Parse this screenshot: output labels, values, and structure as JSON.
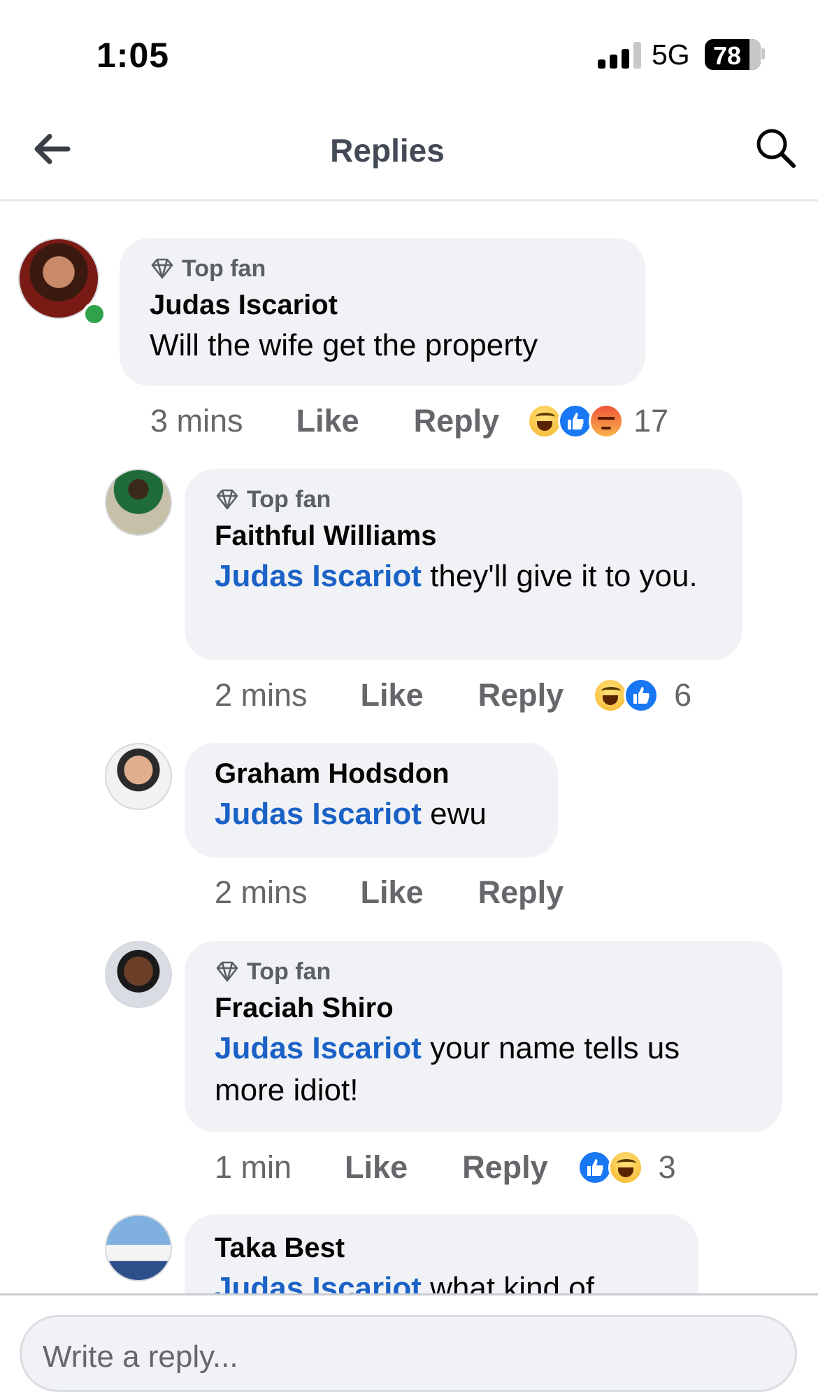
{
  "status": {
    "time": "1:05",
    "network": "5G",
    "battery": "78",
    "battery_level": 0.78
  },
  "header": {
    "title": "Replies"
  },
  "badge_label": "Top fan",
  "comments": [
    {
      "author": "Judas Iscariot",
      "top_fan": true,
      "online": true,
      "mention": "",
      "text": "Will the wife get the property",
      "time": "3 mins",
      "like": "Like",
      "reply": "Reply",
      "reactions": [
        "haha-icon",
        "like-icon",
        "angry-icon"
      ],
      "reaction_count": "17"
    },
    {
      "author": "Faithful Williams",
      "top_fan": true,
      "mention": "Judas Iscariot",
      "text": " they'll give it to you.",
      "time": "2 mins",
      "like": "Like",
      "reply": "Reply",
      "reactions": [
        "haha-icon",
        "like-icon"
      ],
      "reaction_count": "6"
    },
    {
      "author": "Graham Hodsdon",
      "top_fan": false,
      "mention": "Judas Iscariot",
      "text": " ewu",
      "time": "2 mins",
      "like": "Like",
      "reply": "Reply",
      "reactions": [],
      "reaction_count": ""
    },
    {
      "author": "Fraciah Shiro",
      "top_fan": true,
      "mention": "Judas Iscariot",
      "text": " your name tells us more idiot!",
      "time": "1 min",
      "like": "Like",
      "reply": "Reply",
      "reactions": [
        "like-icon",
        "haha-icon"
      ],
      "reaction_count": "3"
    },
    {
      "author": "Taka Best",
      "top_fan": false,
      "mention": "Judas Iscariot",
      "text": " what kind of",
      "time": "",
      "like": "",
      "reply": "",
      "reactions": [],
      "reaction_count": ""
    }
  ],
  "composer": {
    "placeholder": "Write a reply..."
  },
  "colors": {
    "mention": "#1b62c7",
    "bubble": "#f0f2f5",
    "like_blue": "#1877f2",
    "online": "#31a24c"
  }
}
